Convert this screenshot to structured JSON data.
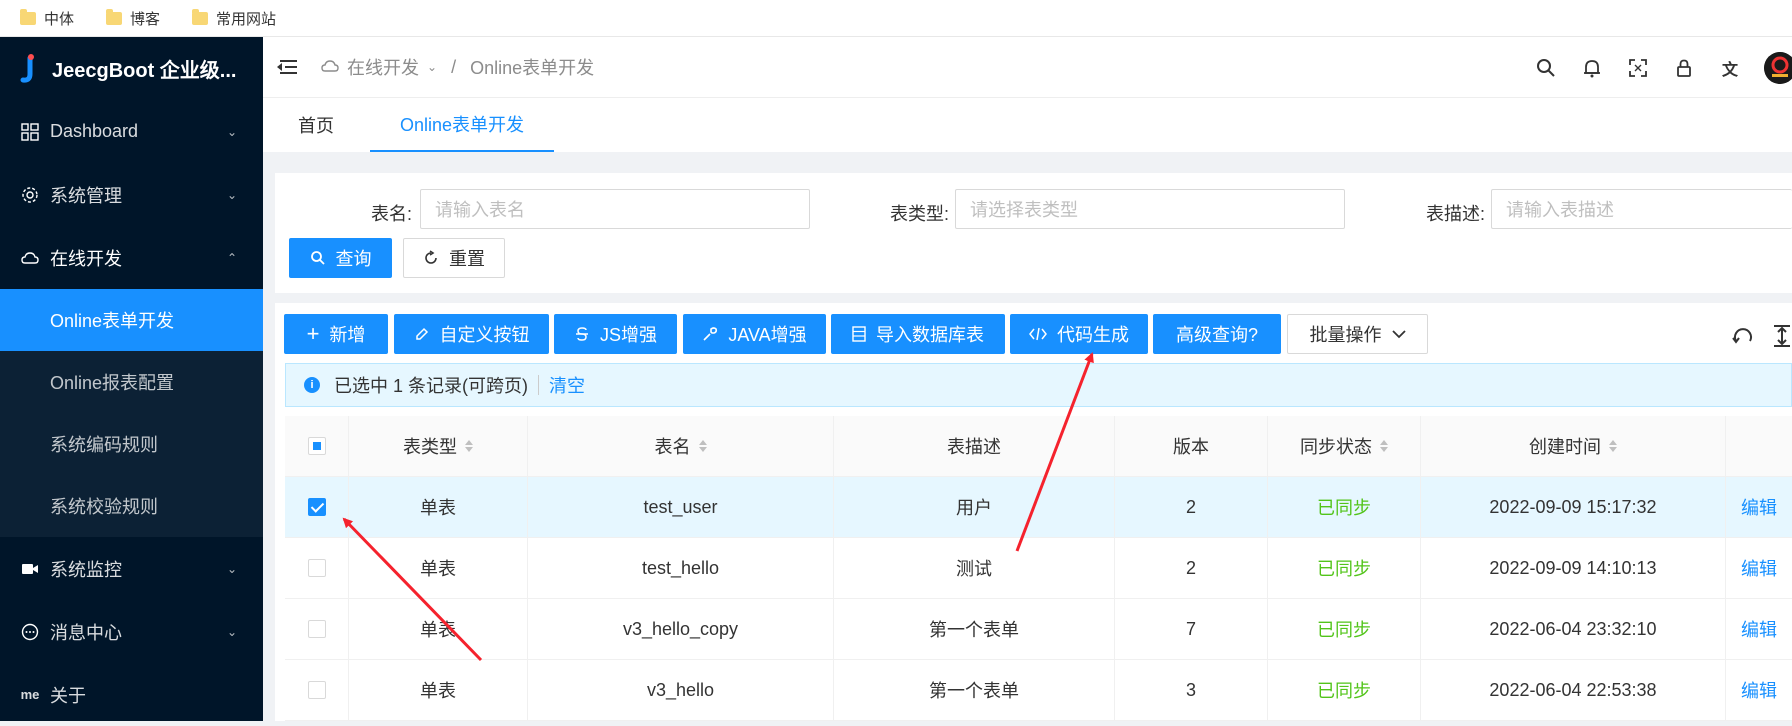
{
  "bookmarks": [
    {
      "label": "中体"
    },
    {
      "label": "博客"
    },
    {
      "label": "常用网站"
    }
  ],
  "app": {
    "title": "JeecgBoot 企业级..."
  },
  "sidebar": {
    "items": [
      {
        "label": "Dashboard",
        "icon": "dashboard-icon"
      },
      {
        "label": "系统管理",
        "icon": "gear-icon"
      },
      {
        "label": "在线开发",
        "icon": "cloud-icon"
      },
      {
        "label": "系统监控",
        "icon": "monitor-icon"
      },
      {
        "label": "消息中心",
        "icon": "message-icon"
      },
      {
        "label": "关于",
        "icon": "me-icon",
        "icon_text": "me"
      }
    ],
    "subitems": [
      {
        "label": "Online表单开发"
      },
      {
        "label": "Online报表配置"
      },
      {
        "label": "系统编码规则"
      },
      {
        "label": "系统校验规则"
      }
    ]
  },
  "header": {
    "breadcrumb": {
      "parent": "在线开发",
      "separator": "/",
      "current": "Online表单开发"
    }
  },
  "tabs": [
    {
      "label": "首页"
    },
    {
      "label": "Online表单开发"
    }
  ],
  "search": {
    "table_name_label": "表名:",
    "table_name_placeholder": "请输入表名",
    "table_type_label": "表类型:",
    "table_type_placeholder": "请选择表类型",
    "table_desc_label": "表描述:",
    "table_desc_placeholder": "请输入表描述",
    "query_label": "查询",
    "reset_label": "重置"
  },
  "toolbar": {
    "add": "新增",
    "custom_button": "自定义按钮",
    "js_enhance": "JS增强",
    "java_enhance": "JAVA增强",
    "import_db": "导入数据库表",
    "code_gen": "代码生成",
    "advanced_query": "高级查询?",
    "batch_ops": "批量操作"
  },
  "alert": {
    "text": "已选中 1 条记录(可跨页)",
    "clear": "清空"
  },
  "table": {
    "columns": [
      "表类型",
      "表名",
      "表描述",
      "版本",
      "同步状态",
      "创建时间",
      ""
    ],
    "rows": [
      {
        "type": "单表",
        "name": "test_user",
        "desc": "用户",
        "version": "2",
        "sync": "已同步",
        "created": "2022-09-09 15:17:32",
        "action": "编辑",
        "checked": true
      },
      {
        "type": "单表",
        "name": "test_hello",
        "desc": "测试",
        "version": "2",
        "sync": "已同步",
        "created": "2022-09-09 14:10:13",
        "action": "编辑",
        "checked": false
      },
      {
        "type": "单表",
        "name": "v3_hello_copy",
        "desc": "第一个表单",
        "version": "7",
        "sync": "已同步",
        "created": "2022-06-04 23:32:10",
        "action": "编辑",
        "checked": false
      },
      {
        "type": "单表",
        "name": "v3_hello",
        "desc": "第一个表单",
        "version": "3",
        "sync": "已同步",
        "created": "2022-06-04 22:53:38",
        "action": "编辑",
        "checked": false
      }
    ]
  },
  "colors": {
    "primary": "#1890ff",
    "sidebar_bg": "#001529",
    "synced": "#52c41a",
    "annotation_arrow": "#f5222d"
  }
}
